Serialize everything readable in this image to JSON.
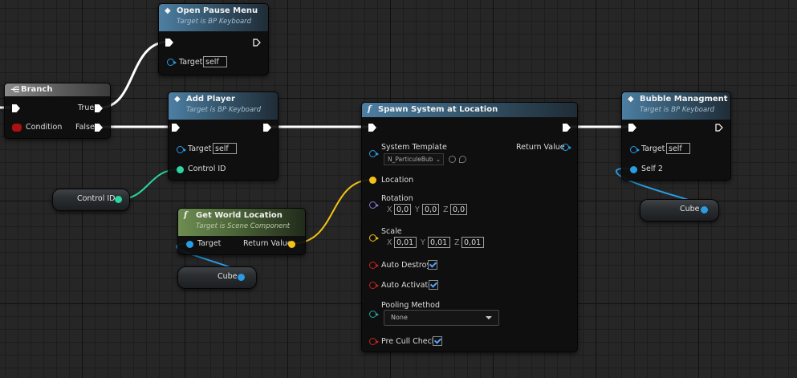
{
  "colors": {
    "exec": "#ffffff",
    "object": "#2b9be2",
    "integer": "#2bd6a3",
    "vector": "#f5c214",
    "boolean": "#cc2222",
    "rotator": "#8a7ad8",
    "enum": "#27a89c",
    "function_header": "#4d7fa3",
    "pure_header": "#6d8d52"
  },
  "nodes": {
    "branch": {
      "title": "Branch",
      "icon": "branch-icon",
      "true_label": "True",
      "false_label": "False",
      "condition_label": "Condition"
    },
    "open_pause": {
      "title": "Open Pause Menu",
      "subtitle": "Target is BP Keyboard",
      "target_label": "Target",
      "target_value": "self",
      "icon": "event-diamond-icon"
    },
    "add_player": {
      "title": "Add Player",
      "subtitle": "Target is BP Keyboard",
      "target_label": "Target",
      "target_value": "self",
      "control_label": "Control ID",
      "icon": "event-diamond-icon"
    },
    "get_world_location": {
      "title": "Get World Location",
      "subtitle": "Target is Scene Component",
      "target_label": "Target",
      "return_label": "Return Value",
      "icon": "function-icon",
      "icon_glyph": "f"
    },
    "spawn_system": {
      "title": "Spawn System at Location",
      "icon": "function-icon",
      "icon_glyph": "f",
      "system_template_label": "System Template",
      "system_template_value": "N_ParticuleBub",
      "return_label": "Return Value",
      "location_label": "Location",
      "rotation_label": "Rotation",
      "rotation": {
        "x": "0,0",
        "y": "0,0",
        "z": "0,0"
      },
      "scale_label": "Scale",
      "scale": {
        "x": "0,01",
        "y": "0,01",
        "z": "0,01"
      },
      "axis": {
        "x": "X",
        "y": "Y",
        "z": "Z"
      },
      "auto_destroy_label": "Auto Destroy",
      "auto_destroy": true,
      "auto_activate_label": "Auto Activate",
      "auto_activate": true,
      "pooling_label": "Pooling Method",
      "pooling_value": "None",
      "pre_cull_label": "Pre Cull Check",
      "pre_cull": true
    },
    "bubble": {
      "title": "Bubble Managment",
      "subtitle": "Target is BP Keyboard",
      "target_label": "Target",
      "target_value": "self",
      "self2_label": "Self 2",
      "icon": "event-diamond-icon"
    }
  },
  "variables": {
    "control_id": "Control ID",
    "cube_a": "Cube",
    "cube_b": "Cube"
  }
}
